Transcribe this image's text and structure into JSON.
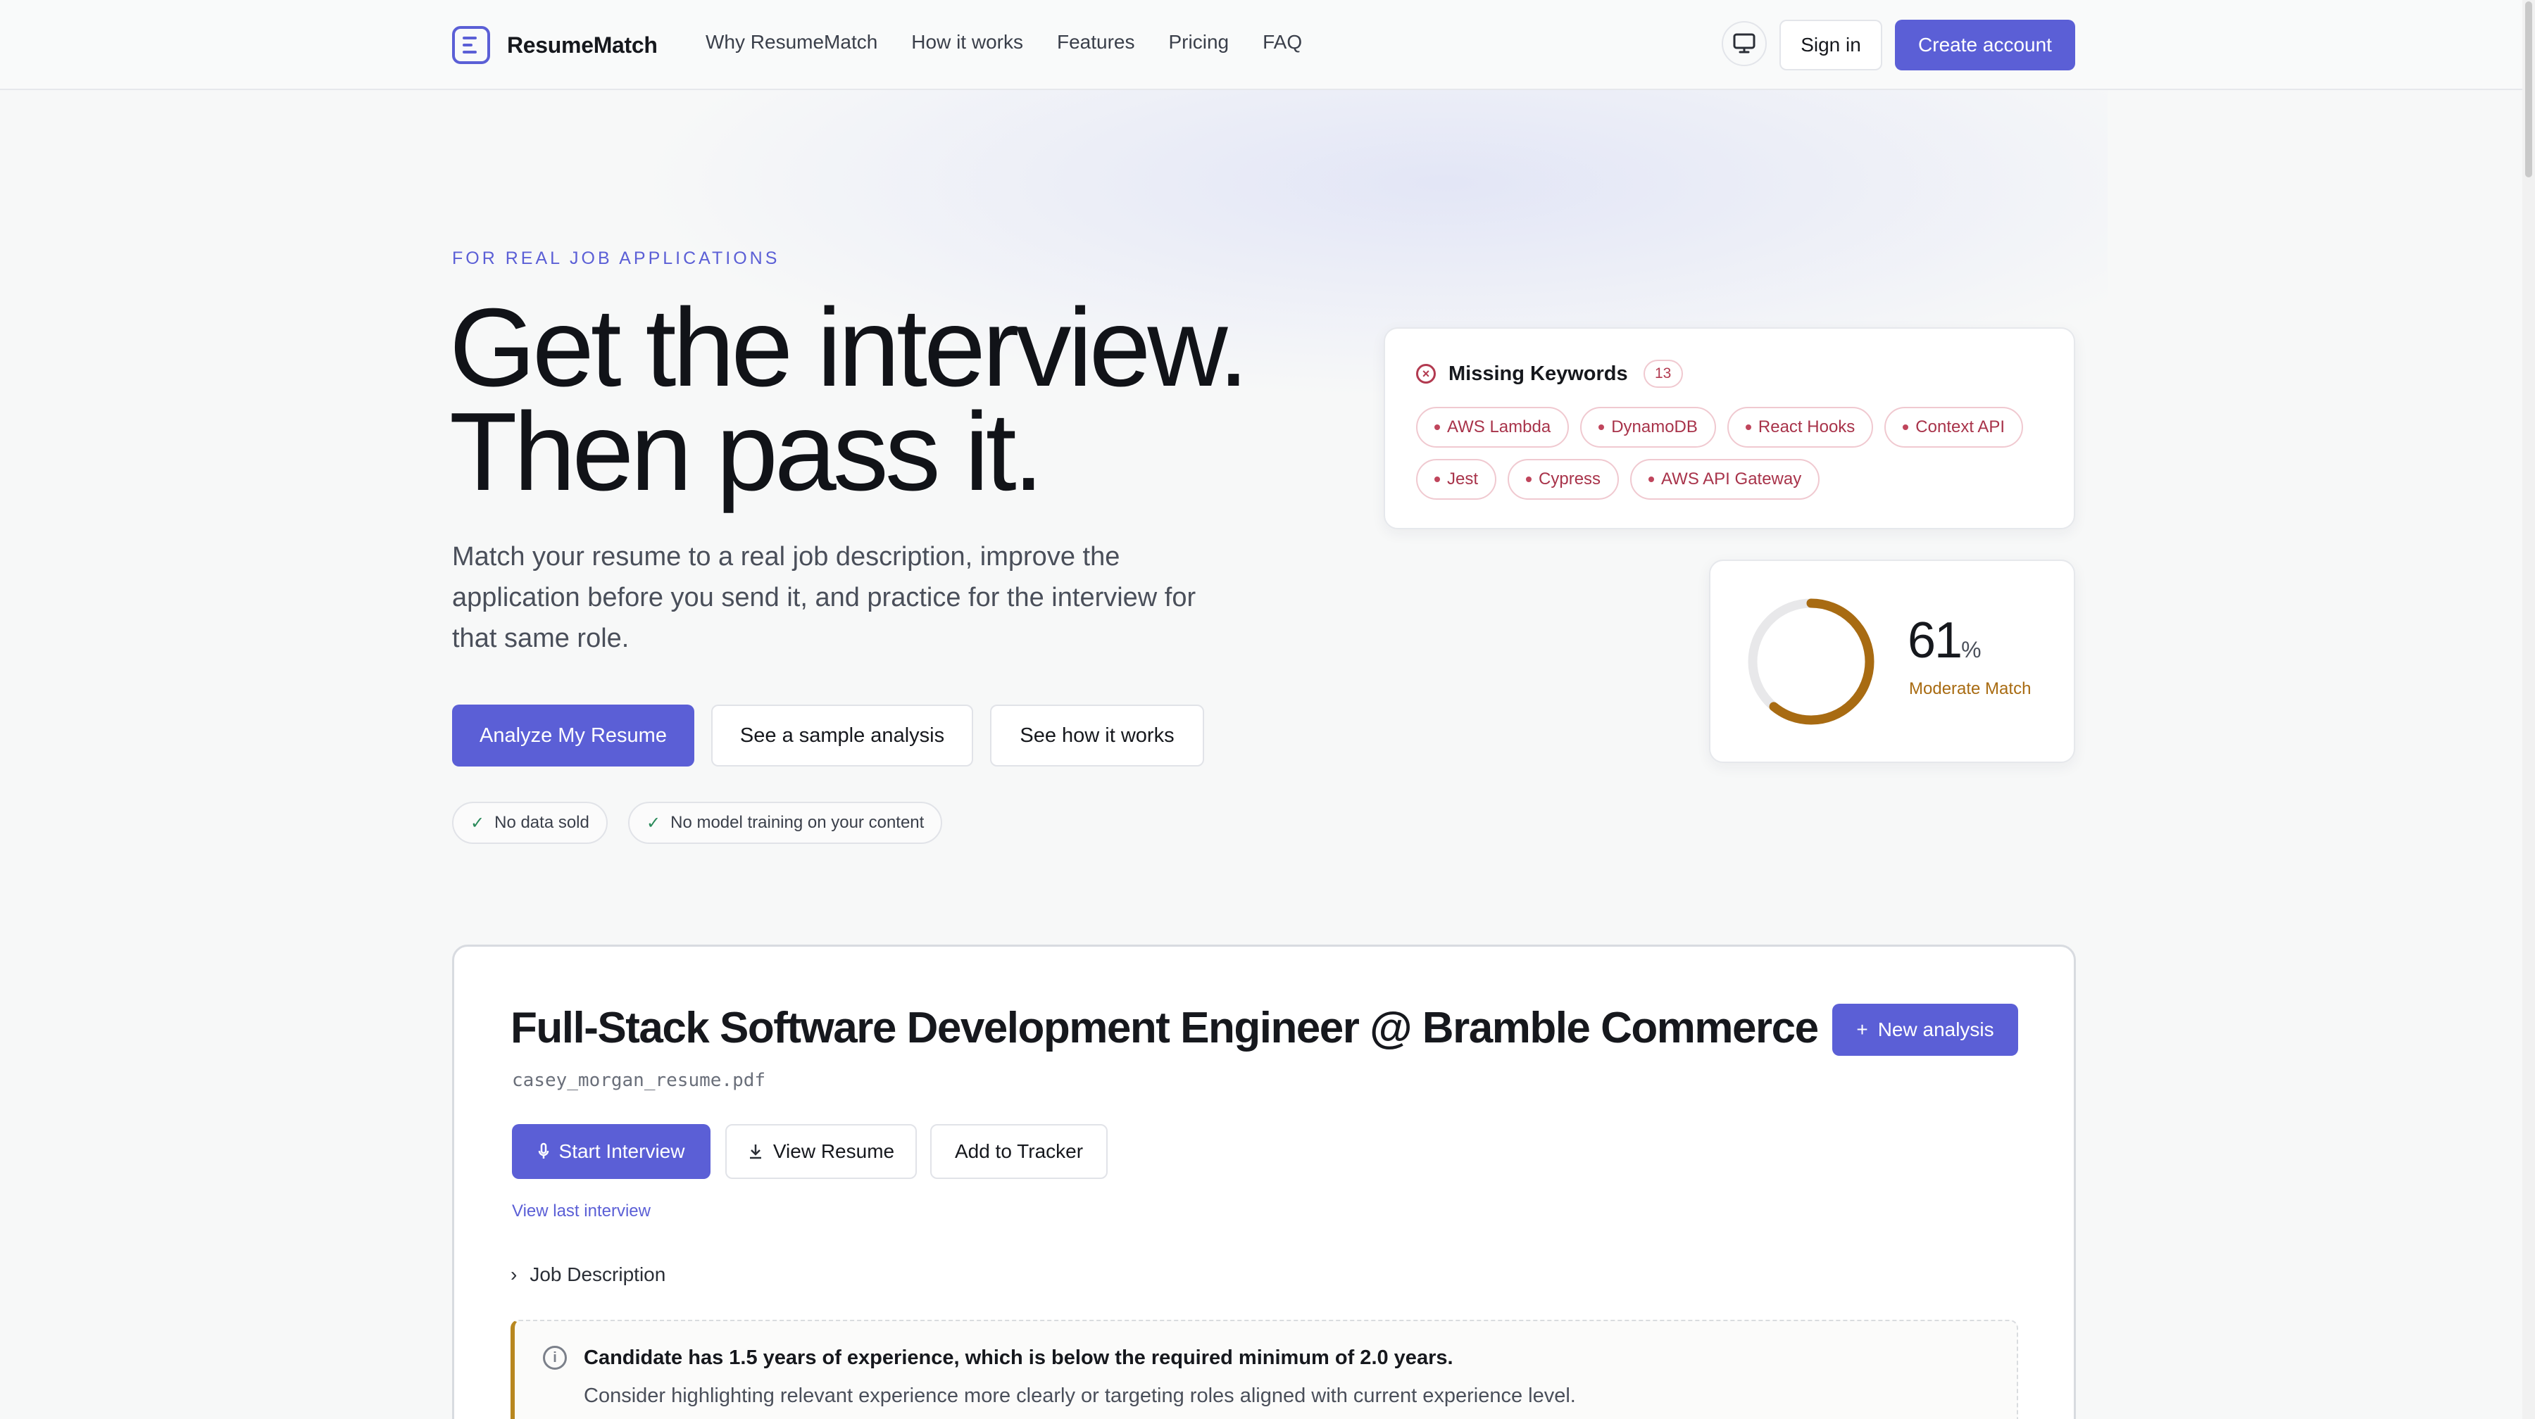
{
  "header": {
    "brand": "ResumeMatch",
    "nav": [
      "Why ResumeMatch",
      "How it works",
      "Features",
      "Pricing",
      "FAQ"
    ],
    "sign_in": "Sign in",
    "create_account": "Create account",
    "theme_icon": "monitor-icon"
  },
  "hero": {
    "eyebrow": "FOR REAL JOB APPLICATIONS",
    "headline_line1": "Get the interview.",
    "headline_line2": "Then pass it.",
    "subtext": "Match your resume to a real job description, improve the application before you send it, and practice for the interview for that same role.",
    "cta_primary": "Analyze My Resume",
    "cta_sample": "See a sample analysis",
    "cta_how": "See how it works",
    "badges": [
      "No data sold",
      "No model training on your content"
    ]
  },
  "keywords_card": {
    "title": "Missing Keywords",
    "count": "13",
    "keywords": [
      "AWS Lambda",
      "DynamoDB",
      "React Hooks",
      "Context API",
      "Jest",
      "Cypress",
      "AWS API Gateway"
    ],
    "colors": {
      "chip_text": "#a8334a",
      "chip_border": "#f0c9d0"
    }
  },
  "score_card": {
    "score": "61",
    "score_value": 0.61,
    "unit": "%",
    "label": "Moderate Match",
    "colors": {
      "ring": "#a86b12",
      "track": "#e8e8ea"
    }
  },
  "analysis": {
    "title": "Full-Stack Software Development Engineer @ Bramble Commerce",
    "file": "casey_morgan_resume.pdf",
    "new_analysis": "New analysis",
    "start_interview": "Start Interview",
    "view_resume": "View Resume",
    "add_tracker": "Add to Tracker",
    "view_last": "View last interview",
    "job_description": "Job Description",
    "alert_title": "Candidate has 1.5 years of experience, which is below the required minimum of 2.0 years.",
    "alert_body": "Consider highlighting relevant experience more clearly or targeting roles aligned with current experience level."
  },
  "colors": {
    "accent": "#5b5fd6",
    "warning": "#b8871f"
  }
}
